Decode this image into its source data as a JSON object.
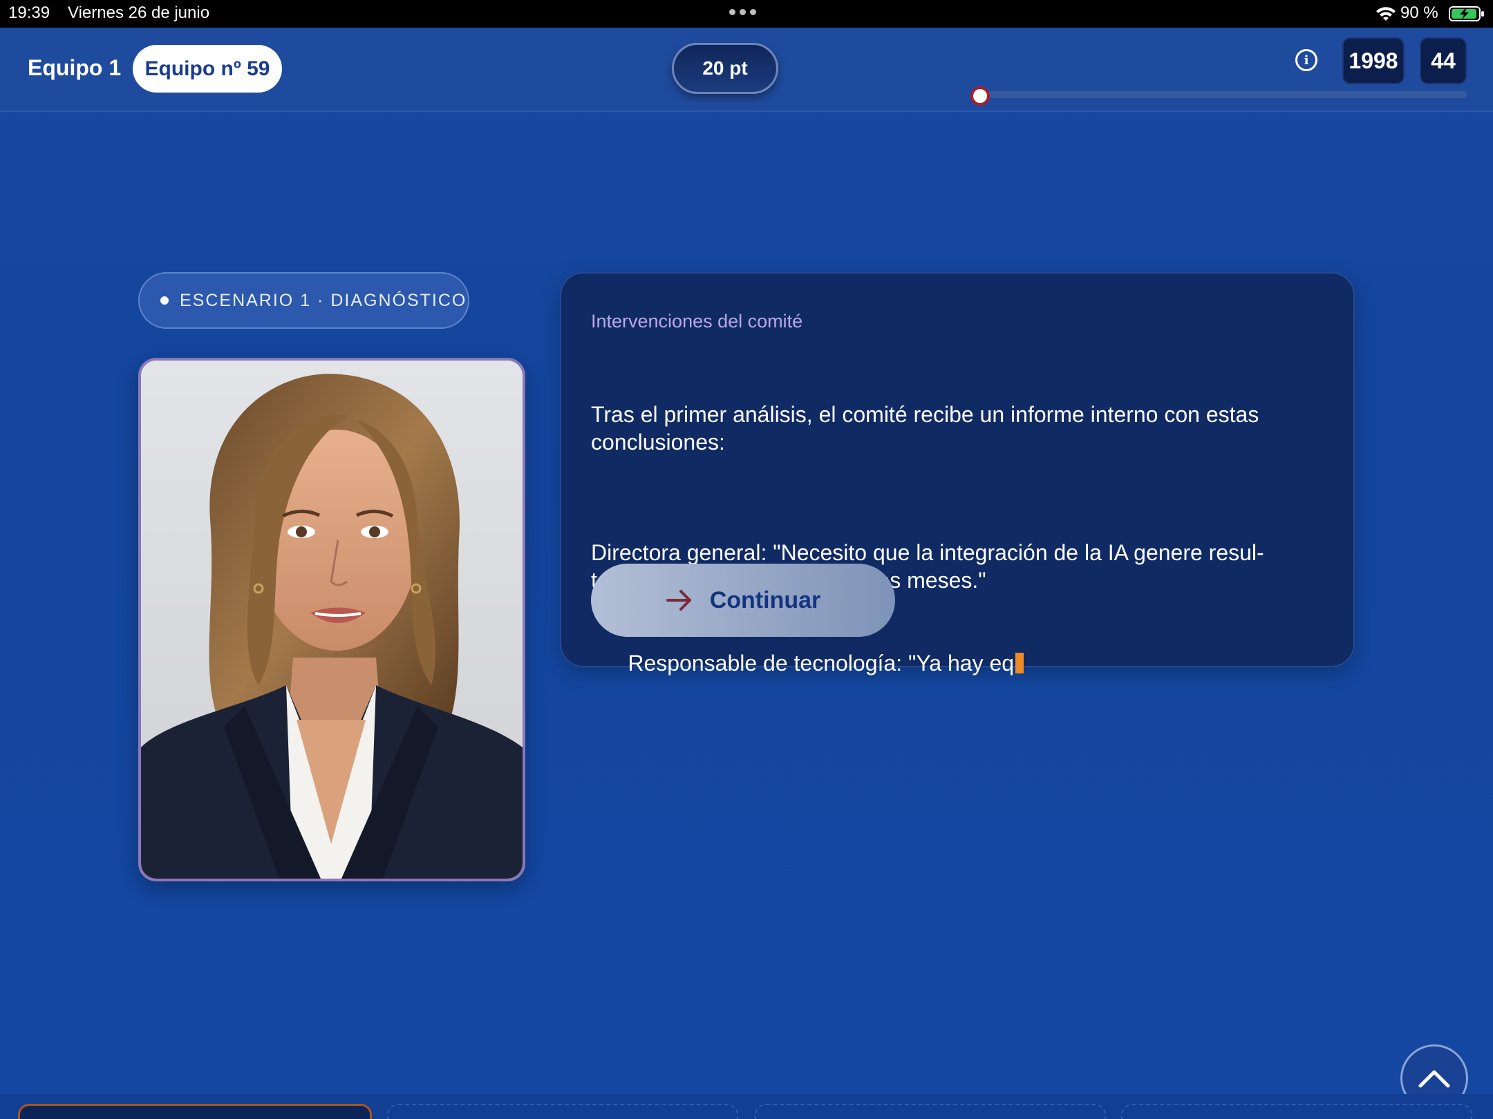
{
  "status_bar": {
    "time": "19:39",
    "date": "Viernes 26 de junio",
    "battery": "90 %"
  },
  "header": {
    "team_label": "Equipo 1",
    "team_pill": "Equipo nº 59",
    "points": "20 pt",
    "counters": [
      "1998",
      "44"
    ],
    "progress": 0.0
  },
  "scenario": {
    "chip": "ESCENARIO 1 · DIAGNÓSTICO"
  },
  "dialog": {
    "label": "Intervenciones del comité",
    "paragraphs": [
      "Tras el primer análisis, el comité recibe un informe interno con estas conclusiones:",
      "Directora general: \"Necesito que la integración de la IA genere resul-\ntados visibles en menos de tres meses.\"",
      "Responsable de tecnología: \"Ya hay eq"
    ],
    "continue_label": "Continuar"
  },
  "colors": {
    "accent": "#13347f",
    "cursor": "#f08a24",
    "progress_knob": "#a31f2d"
  }
}
